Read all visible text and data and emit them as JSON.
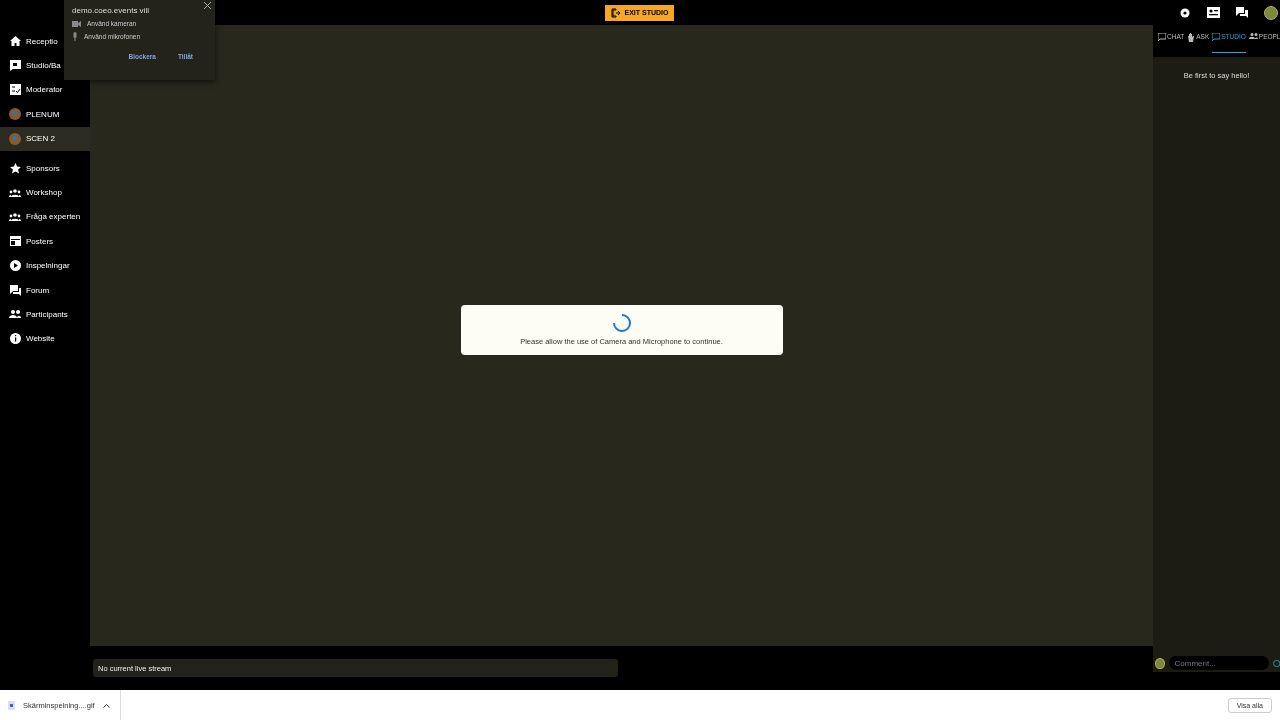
{
  "permission_popup": {
    "title": "demo.coeo.events vill",
    "permissions": [
      {
        "kind": "camera",
        "label": "Använd kameran"
      },
      {
        "kind": "mic",
        "label": "Använd mikrofonen"
      }
    ],
    "buttons": [
      "Blockera",
      "Tillåt"
    ]
  },
  "top_bar": {
    "exit_button": "EXIT STUDIO"
  },
  "sidebar": {
    "items": [
      {
        "kind": "home",
        "label": "Receptio",
        "selected": false
      },
      {
        "kind": "studio",
        "label": "Studio/Ba",
        "selected": false
      },
      {
        "kind": "moderator",
        "label": "Moderator",
        "selected": false
      },
      {
        "kind": "avatar",
        "label": "PLENUM",
        "selected": false
      },
      {
        "kind": "avatar",
        "label": "SCEN 2",
        "selected": true
      },
      {
        "kind": "star",
        "label": "Sponsors",
        "selected": false
      },
      {
        "kind": "group",
        "label": "Workshop",
        "selected": false
      },
      {
        "kind": "group",
        "label": "Fråga experten",
        "selected": false
      },
      {
        "kind": "posters",
        "label": "Posters",
        "selected": false
      },
      {
        "kind": "play",
        "label": "Inspelningar",
        "selected": false
      },
      {
        "kind": "forum",
        "label": "Forum",
        "selected": false
      },
      {
        "kind": "people",
        "label": "Participants",
        "selected": false
      },
      {
        "kind": "info",
        "label": "Website",
        "selected": false
      }
    ]
  },
  "dialog": {
    "message": "Please allow the use of Camera and Microphone to continue."
  },
  "chat_panel": {
    "tabs": [
      {
        "kind": "chat",
        "label": "CHAT",
        "selected": false
      },
      {
        "kind": "hand",
        "label": "ASK",
        "selected": false
      },
      {
        "kind": "studio",
        "label": "STUDIO",
        "selected": true
      },
      {
        "kind": "people",
        "label": "PEOPL",
        "selected": false
      }
    ],
    "empty_message": "Be first to say hello!",
    "comment_placeholder": "Comment..."
  },
  "live_stream_status": "No current live stream",
  "download_bar": {
    "file": "Skärminspelning....gif",
    "show_all": "Visa alla"
  }
}
